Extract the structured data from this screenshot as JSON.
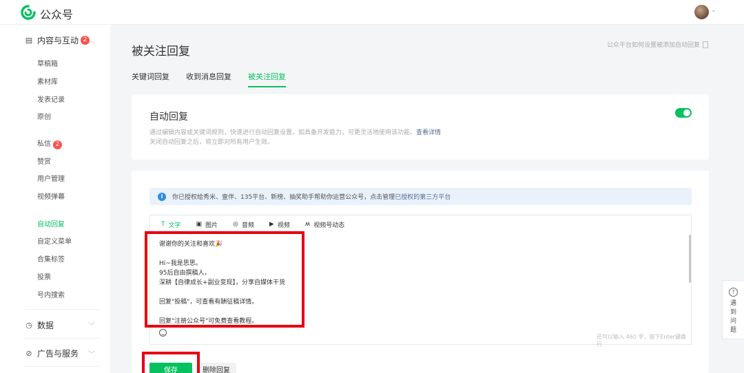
{
  "header": {
    "app_title": "公众号"
  },
  "sidebar": {
    "section_content": "内容与互动",
    "section_content_badge": "2",
    "content_items": [
      "草稿箱",
      "素材库",
      "发表记录",
      "原创"
    ],
    "messages": "私信",
    "messages_badge": "2",
    "items2": [
      "赞赏",
      "用户管理",
      "视频弹幕"
    ],
    "active_item": "自动回复",
    "items3": [
      "自定义菜单",
      "合集标签",
      "投票",
      "号内搜索"
    ],
    "section_data": "数据",
    "section_ads": "广告与服务"
  },
  "page": {
    "title": "被关注回复",
    "help_link": "公众平台如何设置被添加自动回复",
    "tabs": [
      "关键词回复",
      "收到消息回复",
      "被关注回复"
    ],
    "active_tab_index": 2
  },
  "auto_reply": {
    "title": "自动回复",
    "desc1": "通过编辑内容或关键词规则，快速进行自动回复设置。如具备开发能力，可更灵活地使用该功能。",
    "desc1_link": "查看详情",
    "desc2": "关闭自动回复之后，将立即对所有用户生效。",
    "enabled": true
  },
  "notice": {
    "text": "你已授权给秀米、壹伴、135平台、新榜、抽奖助手帮助你运营公众号，点击管理",
    "link": "已授权的第三方平台"
  },
  "editor": {
    "tools": [
      {
        "icon": "text-icon",
        "glyph": "T",
        "label": "文字"
      },
      {
        "icon": "image-icon",
        "glyph": "▣",
        "label": "图片"
      },
      {
        "icon": "audio-icon",
        "glyph": "◎",
        "label": "音频"
      },
      {
        "icon": "video-icon",
        "glyph": "▶",
        "label": "视频"
      },
      {
        "icon": "channels-icon",
        "glyph": "ʍ",
        "label": "视频号动态"
      }
    ],
    "lines": [
      "谢谢你的关注和喜欢🎉",
      "",
      "Hi~我是思思。",
      "95后自由撰稿人，",
      "深耕【自律成长+副业变现】，分享自媒体干货",
      "",
      "回复\"投稿\"，可查看有酬征稿详情。",
      "",
      "回复\"注册公众号\"可免费查看教程。"
    ],
    "counter": "还可以输入 460 字，按下Enter键换行"
  },
  "buttons": {
    "save": "保存",
    "delete": "删除回复"
  },
  "float_help": {
    "text": "遇到问题"
  },
  "colors": {
    "brand": "#07c160",
    "highlight_box": "#e60012",
    "link": "#576b95"
  }
}
